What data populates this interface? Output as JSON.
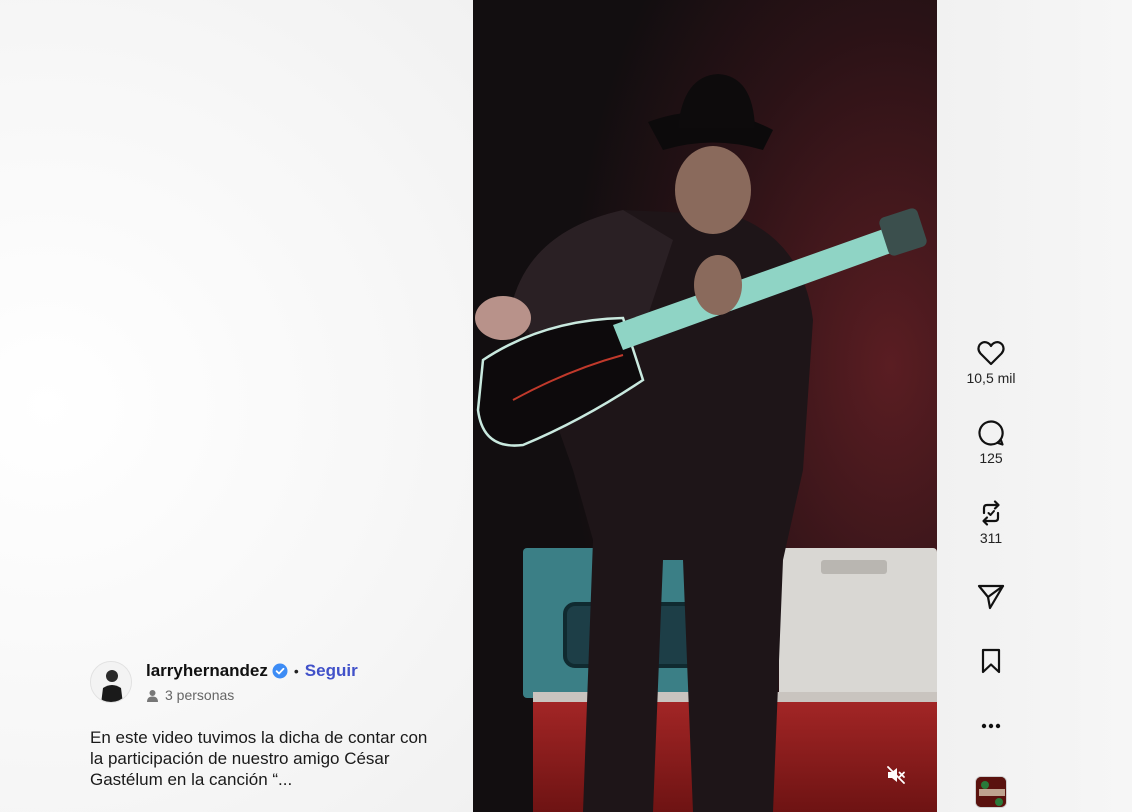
{
  "post": {
    "username": "larryhernandez",
    "follow_label": "Seguir",
    "separator": "•",
    "collaborators": "3 personas",
    "caption": "En este video tuvimos la dicha de contar con la participación de nuestro amigo César Gastélum en la canción “..."
  },
  "actions": {
    "likes": "10,5 mil",
    "comments": "125",
    "reposts": "311"
  },
  "icons": {
    "like": "heart-icon",
    "comment": "comment-bubble-icon",
    "repost": "repost-icon",
    "share": "send-icon",
    "save": "bookmark-icon",
    "more": "more-options-icon",
    "mute": "muted-speaker-icon",
    "verified": "verified-badge-icon",
    "collaborators": "person-icon"
  },
  "colors": {
    "accent": "#4151c9",
    "verified": "#3d8cf5"
  }
}
